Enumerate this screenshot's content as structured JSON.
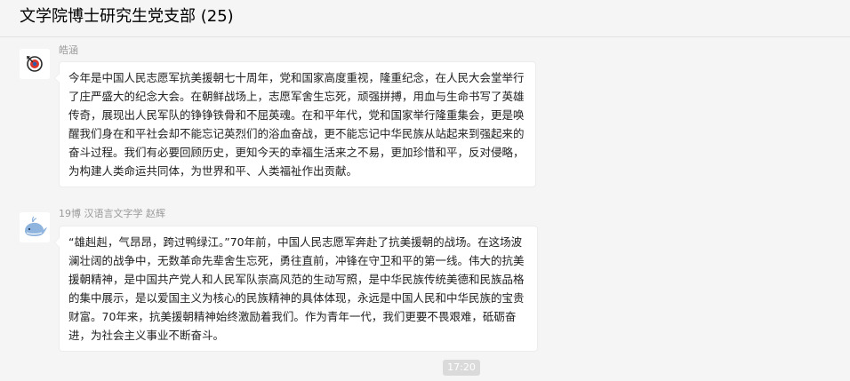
{
  "header": {
    "title": "文学院博士研究生党支部 (25)"
  },
  "messages": [
    {
      "sender": "皓涵",
      "avatar_icon": "target-icon",
      "text": "今年是中国人民志愿军抗美援朝七十周年，党和国家高度重视，隆重纪念，在人民大会堂举行了庄严盛大的纪念大会。在朝鲜战场上，志愿军舍生忘死，顽强拼搏，用血与生命书写了英雄传奇，展现出人民军队的铮铮铁骨和不屈英魂。在和平年代，党和国家举行隆重集会，更是唤醒我们身在和平社会却不能忘记英烈们的浴血奋战，更不能忘记中华民族从站起来到强起来的奋斗过程。我们有必要回顾历史，更知今天的幸福生活来之不易，更加珍惜和平，反对侵略，为构建人类命运共同体，为世界和平、人类福祉作出贡献。"
    },
    {
      "sender": "19博 汉语言文字学 赵辉",
      "avatar_icon": "whale-icon",
      "text": "“雄赳赳，气昂昂，跨过鸭绿江。”70年前，中国人民志愿军奔赴了抗美援朝的战场。在这场波澜壮阔的战争中，无数革命先辈舍生忘死，勇往直前，冲锋在守卫和平的第一线。伟大的抗美援朝精神，是中国共产党人和人民军队崇高风范的生动写照，是中华民族传统美德和民族品格的集中展示，是以爱国主义为核心的民族精神的具体体现，永远是中国人民和中华民族的宝贵财富。70年来，抗美援朝精神始终激励着我们。作为青年一代，我们更要不畏艰难，砥砺奋进，为社会主义事业不断奋斗。"
    }
  ],
  "time_divider": "17:20"
}
